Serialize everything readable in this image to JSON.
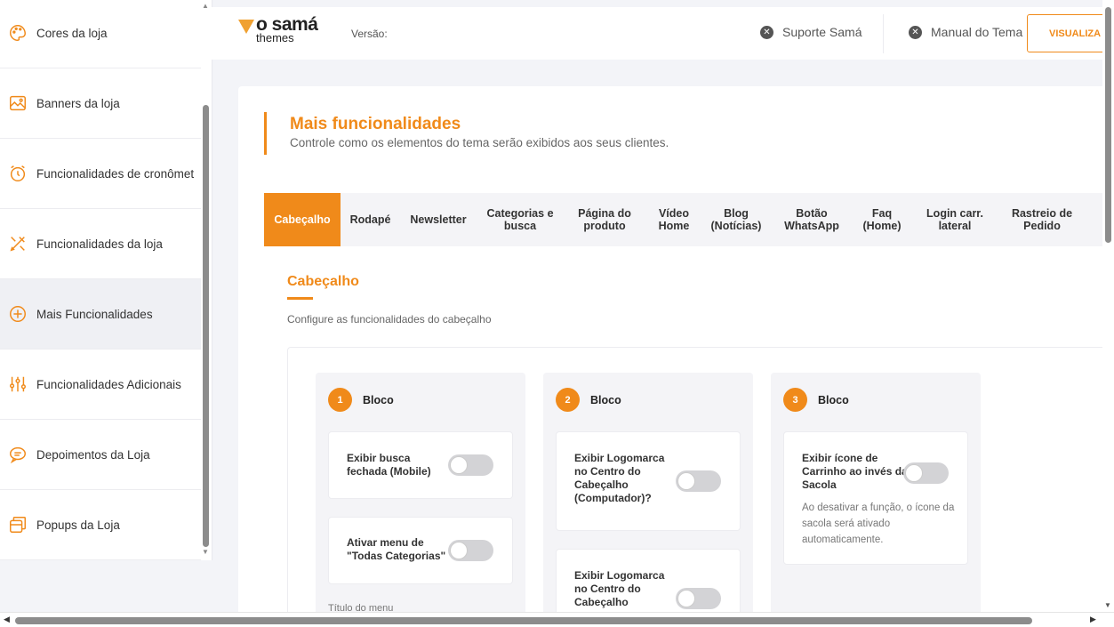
{
  "sidebar": {
    "items": [
      {
        "label": "Cores da loja",
        "icon": "palette-icon"
      },
      {
        "label": "Banners da loja",
        "icon": "image-icon"
      },
      {
        "label": "Funcionalidades de cronômet",
        "icon": "alarm-clock-icon"
      },
      {
        "label": "Funcionalidades da loja",
        "icon": "tools-icon"
      },
      {
        "label": "Mais Funcionalidades",
        "icon": "plus-circle-icon"
      },
      {
        "label": "Funcionalidades Adicionais",
        "icon": "sliders-icon"
      },
      {
        "label": "Depoimentos da Loja",
        "icon": "chat-icon"
      },
      {
        "label": "Popups da Loja",
        "icon": "popup-icon"
      }
    ],
    "active_index": 4
  },
  "header": {
    "logo_line1": "o samá",
    "logo_line2": "themes",
    "version_label": "Versão:",
    "support_link": "Suporte Samá",
    "manual_link": "Manual do Tema",
    "preview_button": "VISUALIZA"
  },
  "main": {
    "title": "Mais funcionalidades",
    "subtitle": "Controle como os elementos do tema serão exibidos aos seus clientes.",
    "tabs": [
      {
        "label": "Cabeçalho"
      },
      {
        "label": "Rodapé"
      },
      {
        "label": "Newsletter"
      },
      {
        "label": "Categorias e busca"
      },
      {
        "label": "Página do produto"
      },
      {
        "label": "Vídeo Home"
      },
      {
        "label": "Blog (Notícias)"
      },
      {
        "label": "Botão WhatsApp"
      },
      {
        "label": "Faq (Home)"
      },
      {
        "label": "Login carr. lateral"
      },
      {
        "label": "Rastreio de Pedido"
      }
    ],
    "active_tab": 0,
    "section_title": "Cabeçalho",
    "section_desc": "Configure as funcionalidades do cabeçalho",
    "blocks": [
      {
        "number": "1",
        "label": "Bloco",
        "options": [
          {
            "label": "Exibir busca fechada (Mobile)",
            "enabled": false
          },
          {
            "label": "Ativar menu de \"Todas Categorias\"",
            "enabled": false
          }
        ],
        "menu_title_label": "Título do menu"
      },
      {
        "number": "2",
        "label": "Bloco",
        "options": [
          {
            "label": "Exibir Logomarca no Centro do Cabeçalho (Computador)?",
            "enabled": false
          },
          {
            "label": "Exibir Logomarca no Centro do Cabeçalho",
            "enabled": false
          }
        ]
      },
      {
        "number": "3",
        "label": "Bloco",
        "options": [
          {
            "label": "Exibir ícone de Carrinho ao invés da Sacola",
            "description": "Ao desativar a função, o ícone da sacola será ativado automaticamente.",
            "enabled": false
          }
        ]
      }
    ]
  },
  "colors": {
    "accent": "#f08a1a",
    "text": "#333333",
    "muted": "#666666"
  }
}
